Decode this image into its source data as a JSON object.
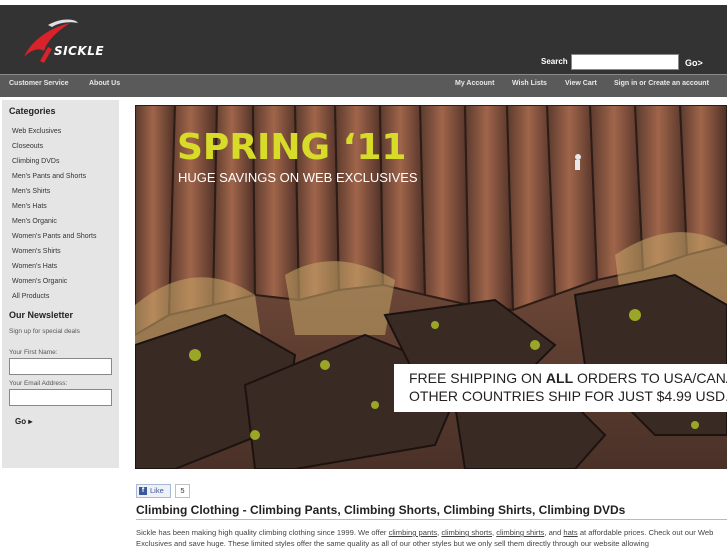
{
  "header": {
    "brand": "SICKLE",
    "search_label": "Search",
    "search_value": "",
    "search_go": "Go>"
  },
  "nav": {
    "left": [
      "Customer Service",
      "About Us"
    ],
    "right": [
      "My Account",
      "Wish Lists",
      "View Cart",
      "Sign in or Create an account"
    ]
  },
  "sidebar": {
    "categories_title": "Categories",
    "categories": [
      "Web Exclusives",
      "Closeouts",
      "Climbing DVDs",
      "Men's Pants and Shorts",
      "Men's Shirts",
      "Men's Hats",
      "Men's Organic",
      "Women's Pants and Shorts",
      "Women's Shirts",
      "Women's Hats",
      "Women's Organic",
      "All Products"
    ],
    "newsletter_title": "Our Newsletter",
    "newsletter_text": "Sign up for special deals",
    "first_name_label": "Your First Name:",
    "email_label": "Your Email Address:",
    "first_name_value": "",
    "email_value": "",
    "go_label": "Go ▸"
  },
  "hero": {
    "title": "SPRING ‘11",
    "subtitle": "HUGE SAVINGS ON WEB EXCLUSIVES",
    "promo_line1_pre": "FREE SHIPPING ON ",
    "promo_line1_bold": "ALL",
    "promo_line1_post": " ORDERS TO USA/CANADA!",
    "promo_line2": "OTHER COUNTRIES SHIP FOR JUST $4.99 USD."
  },
  "social": {
    "like_label": "Like",
    "like_count": "5"
  },
  "content": {
    "heading": "Climbing Clothing - Climbing Pants, Climbing Shorts, Climbing Shirts, Climbing DVDs",
    "intro_1": "Sickle has been making high quality climbing clothing since 1999. We offer ",
    "link_pants": "climbing pants",
    "sep_1": ", ",
    "link_shorts": "climbing shorts",
    "sep_2": ", ",
    "link_shirts": "climbing shirts",
    "sep_3": ", and ",
    "link_hats": "hats",
    "intro_2": " at affordable prices. Check out our Web Exclusives and save huge. These limited styles offer the same quality as all of our other styles but we only sell them directly through our website allowing"
  },
  "colors": {
    "header_bg": "#333333",
    "nav_bg": "#5a5a5a",
    "sidebar_bg": "#e5e5e5",
    "accent_yellow": "#d7dc28",
    "logo_red": "#d8232a"
  }
}
